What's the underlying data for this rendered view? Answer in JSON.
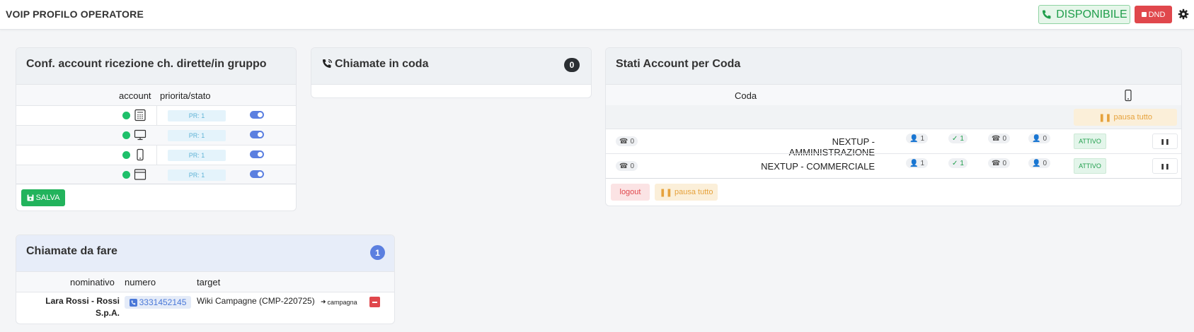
{
  "header": {
    "title": "VOIP PROFILO OPERATORE",
    "disponibile_label": "DISPONIBILE",
    "dnd_label": "DND"
  },
  "conf_card": {
    "title": "Conf. account ricezione ch. dirette/in gruppo",
    "col_account": "account",
    "col_priorita": "priorita/stato",
    "rows": [
      {
        "device": "calculator-icon",
        "priority": "PR: 1"
      },
      {
        "device": "monitor-icon",
        "priority": "PR: 1"
      },
      {
        "device": "mobile-icon",
        "priority": "PR: 1"
      },
      {
        "device": "browser-window-icon",
        "priority": "PR: 1"
      }
    ],
    "save_label": "SALVA"
  },
  "coda_card": {
    "title": "Chiamate in coda",
    "count": "0"
  },
  "stati_card": {
    "title": "Stati Account per Coda",
    "col_coda": "Coda",
    "pausa_tutto_label": "pausa tutto",
    "queues": [
      {
        "calls": "0",
        "name": "NEXTUP - AMMINISTRAZIONE",
        "agents": "1",
        "agents_ok": "1",
        "calls_active": "0",
        "agents_busy": "0",
        "status": "ATTIVO"
      },
      {
        "calls": "0",
        "name": "NEXTUP - COMMERCIALE",
        "agents": "1",
        "agents_ok": "1",
        "calls_active": "0",
        "agents_busy": "0",
        "status": "ATTIVO"
      }
    ],
    "logout_label": "logout",
    "footer_pausa_label": "pausa tutto"
  },
  "da_fare_card": {
    "title": "Chiamate da fare",
    "count": "1",
    "col_nominativo": "nominativo",
    "col_numero": "numero",
    "col_target": "target",
    "rows": [
      {
        "nominativo_line1": "Lara Rossi - Rossi",
        "nominativo_line2": "S.p.A.",
        "numero": "3331452145",
        "target": "Wiki Campagne (CMP-220725)",
        "target_tag": "campagna"
      }
    ]
  },
  "colors": {
    "accent_blue": "#5b7fe0",
    "green": "#1ec06a",
    "red": "#e0474c",
    "orange": "#e6a23c"
  }
}
